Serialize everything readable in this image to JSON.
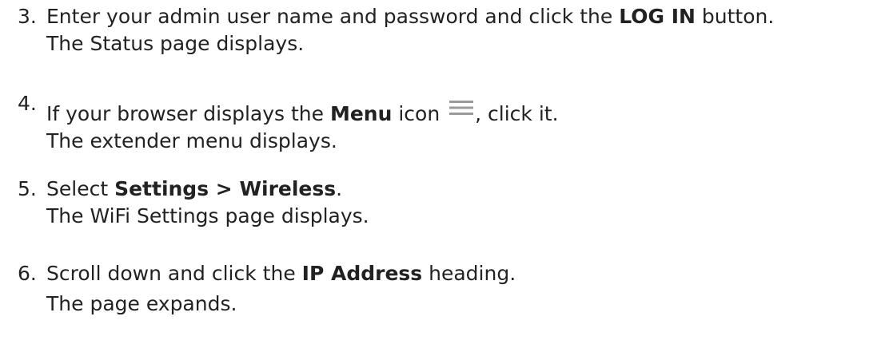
{
  "steps": [
    {
      "number": "3.",
      "pre": "Enter your admin user name and password and click the ",
      "bold": "LOG IN",
      "post": " button.",
      "result": "The Status page displays."
    },
    {
      "number": "4.",
      "pre": "If your browser displays the ",
      "bold": "Menu",
      "mid": " icon ",
      "icon": "hamburger-menu-icon",
      "post": ", click it.",
      "result": "The extender menu displays."
    },
    {
      "number": "5.",
      "pre": "Select ",
      "bold": "Settings > Wireless",
      "post": ".",
      "result": "The WiFi Settings page displays."
    },
    {
      "number": "6.",
      "pre": "Scroll down and click the ",
      "bold": "IP Address",
      "post": " heading.",
      "result": "The page expands."
    }
  ],
  "colors": {
    "text": "#222222",
    "icon": "#9a9a9a"
  }
}
